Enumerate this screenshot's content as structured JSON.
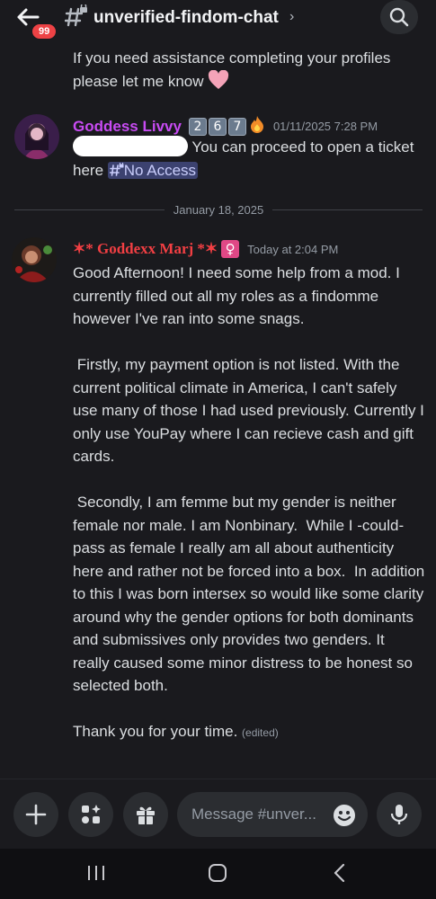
{
  "header": {
    "channel_name": "unverified-findom-chat",
    "unread_badge": "99",
    "chevron": "›"
  },
  "messages": [
    {
      "continuation_text": "If you need assistance completing your profiles please let me know",
      "emoji": "pink-heart"
    },
    {
      "author": "Goddess Livvy",
      "badge_digits": [
        "2",
        "6",
        "7"
      ],
      "badge_emoji": "fire",
      "timestamp": "01/11/2025 7:28 PM",
      "text_after_redaction": " You can proceed to open a ticket here ",
      "channel_mention": "No Access"
    },
    {
      "author": "✶* Goddexx Marj *✶",
      "role_icon": "♀",
      "timestamp": "Today at 2:04 PM",
      "paragraphs": [
        "Good Afternoon! I need some help from a mod. I currently filled out all my roles as a findomme however I've ran into some snags.",
        " Firstly, my payment option is not listed. With the current political climate in America, I can't safely use many of those I had used previously. Currently I only use YouPay where I can recieve cash and gift cards.",
        " Secondly, I am femme but my gender is neither female nor male. I am Nonbinary.  While I -could- pass as female I really am all about authenticity here and rather not be forced into a box.  In addition to this I was born intersex so would like some clarity around why the gender options for both dominants and submissives only provides two genders. It really caused some minor distress to be honest so selected both.",
        "Thank you for your time."
      ],
      "edited_label": "(edited)"
    }
  ],
  "date_divider": "January 18, 2025",
  "composer": {
    "placeholder": "Message #unver..."
  },
  "colors": {
    "background": "#1a1a1e",
    "username_livvy": "#c84bf3",
    "username_marj": "#f23f43",
    "badge_red": "#ed4245"
  }
}
